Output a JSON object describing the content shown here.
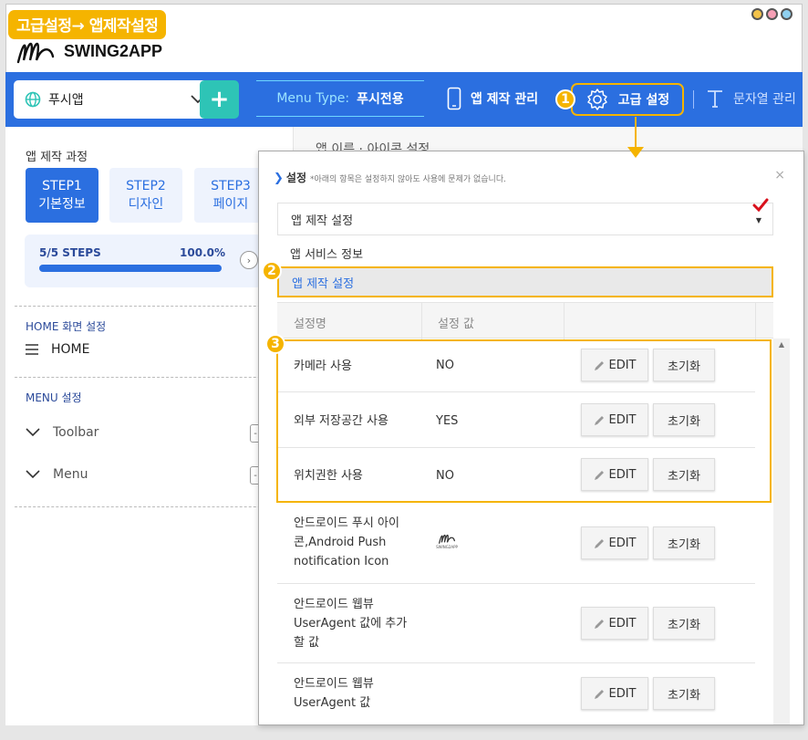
{
  "callout_title": "고급설정→ 앱제작설정",
  "brand": {
    "name": "SWING2APP",
    "mini_name": "SWING2APP"
  },
  "navbar": {
    "app_select_value": "푸시앱",
    "add_label": "+",
    "menu_type_key": "Menu Type:",
    "menu_type_value": "푸시전용",
    "app_manage": "앱 제작 관리",
    "advanced_settings": "고급 설정",
    "string_manage": "문자열 관리"
  },
  "badges": [
    "1",
    "2",
    "3"
  ],
  "sidebar": {
    "process_title": "앱 제작 과정",
    "steps": [
      {
        "line1": "STEP1",
        "line2": "기본정보"
      },
      {
        "line1": "STEP2",
        "line2": "디자인"
      },
      {
        "line1": "STEP3",
        "line2": "페이지"
      }
    ],
    "progress_label": "5/5 STEPS",
    "progress_percent": "100.0%",
    "progress_fraction": 1.0,
    "home_section": "HOME 화면 설정",
    "home_item": "HOME",
    "menu_section": "MENU 설정",
    "menu_items": [
      "Toolbar",
      "Menu"
    ]
  },
  "background": {
    "heading": "앱 이름 · 아이콘 설정"
  },
  "panel": {
    "title": "설정",
    "note": "*아래의 항목은 설정하지 않아도 사용에 문제가 없습니다.",
    "close": "×",
    "select_value": "앱 제작 설정",
    "dropdown_options": [
      "앱 서비스 정보",
      "앱 제작 설정"
    ],
    "columns": [
      "설정명",
      "설정 값"
    ],
    "edit_label": "EDIT",
    "reset_label": "초기화",
    "rows": [
      {
        "name": "카메라 사용",
        "value": "NO"
      },
      {
        "name": "외부 저장공간 사용",
        "value": "YES"
      },
      {
        "name": "위치권한 사용",
        "value": "NO"
      },
      {
        "name": "안드로이드 푸시 아이콘,Android Push notification Icon",
        "value": ""
      },
      {
        "name": "안드로이드 웹뷰 UserAgent 값에 추가할 값",
        "value": ""
      },
      {
        "name": "안드로이드 웹뷰 UserAgent 값",
        "value": ""
      }
    ]
  },
  "colors": {
    "primary": "#2b6fe0",
    "highlight": "#f5b400",
    "teal": "#2ec4b6"
  }
}
